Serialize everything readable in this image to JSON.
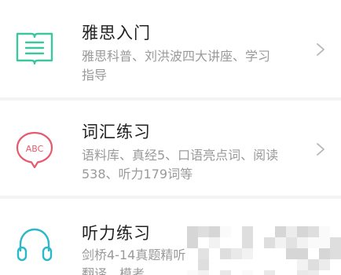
{
  "items": [
    {
      "title": "雅思入门",
      "desc_line1": "雅思科普、刘洪波四大讲座、学习",
      "desc_line2": "指导",
      "icon": "book-icon",
      "icon_color": "#3cc6a0"
    },
    {
      "title": "词汇练习",
      "desc_line1": "语料库、真经5、口语亮点词、阅读",
      "desc_line2": "538、听力179词等",
      "icon": "abc-speech-bubble-icon",
      "icon_color": "#e8596e",
      "icon_text": "ABC"
    },
    {
      "title": "听力练习",
      "desc_line1": "剑桥4-14真题精听",
      "desc_line2": "翻译、模考",
      "icon": "headphones-icon",
      "icon_color": "#2bb8c8"
    }
  ],
  "colors": {
    "title": "#222222",
    "desc": "#9a9a9a",
    "chevron": "#b5b5b5",
    "separator": "#f4f4f4"
  }
}
